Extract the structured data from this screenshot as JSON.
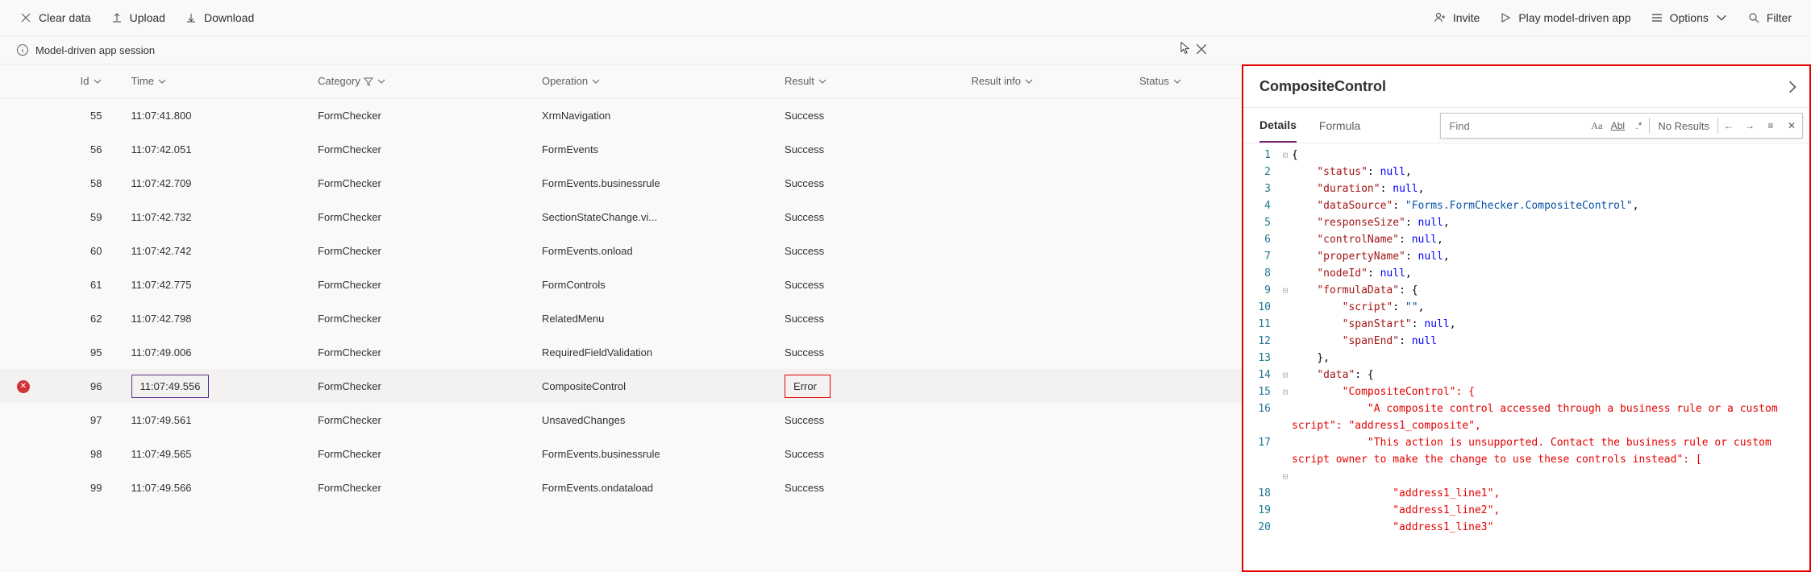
{
  "toolbar": {
    "left": {
      "clear": "Clear data",
      "upload": "Upload",
      "download": "Download"
    },
    "right": {
      "invite": "Invite",
      "play": "Play model-driven app",
      "options": "Options",
      "filter": "Filter"
    }
  },
  "session_bar": "Model-driven app session",
  "grid": {
    "headers": {
      "id": "Id",
      "time": "Time",
      "category": "Category",
      "operation": "Operation",
      "result": "Result",
      "result_info": "Result info",
      "status": "Status"
    },
    "rows": [
      {
        "id": "55",
        "time": "11:07:41.800",
        "category": "FormChecker",
        "operation": "XrmNavigation",
        "result": "Success",
        "err": false,
        "sel": false
      },
      {
        "id": "56",
        "time": "11:07:42.051",
        "category": "FormChecker",
        "operation": "FormEvents",
        "result": "Success",
        "err": false,
        "sel": false
      },
      {
        "id": "58",
        "time": "11:07:42.709",
        "category": "FormChecker",
        "operation": "FormEvents.businessrule",
        "result": "Success",
        "err": false,
        "sel": false
      },
      {
        "id": "59",
        "time": "11:07:42.732",
        "category": "FormChecker",
        "operation": "SectionStateChange.vi...",
        "result": "Success",
        "err": false,
        "sel": false
      },
      {
        "id": "60",
        "time": "11:07:42.742",
        "category": "FormChecker",
        "operation": "FormEvents.onload",
        "result": "Success",
        "err": false,
        "sel": false
      },
      {
        "id": "61",
        "time": "11:07:42.775",
        "category": "FormChecker",
        "operation": "FormControls",
        "result": "Success",
        "err": false,
        "sel": false
      },
      {
        "id": "62",
        "time": "11:07:42.798",
        "category": "FormChecker",
        "operation": "RelatedMenu",
        "result": "Success",
        "err": false,
        "sel": false
      },
      {
        "id": "95",
        "time": "11:07:49.006",
        "category": "FormChecker",
        "operation": "RequiredFieldValidation",
        "result": "Success",
        "err": false,
        "sel": false
      },
      {
        "id": "96",
        "time": "11:07:49.556",
        "category": "FormChecker",
        "operation": "CompositeControl",
        "result": "Error",
        "err": true,
        "sel": true
      },
      {
        "id": "97",
        "time": "11:07:49.561",
        "category": "FormChecker",
        "operation": "UnsavedChanges",
        "result": "Success",
        "err": false,
        "sel": false
      },
      {
        "id": "98",
        "time": "11:07:49.565",
        "category": "FormChecker",
        "operation": "FormEvents.businessrule",
        "result": "Success",
        "err": false,
        "sel": false
      },
      {
        "id": "99",
        "time": "11:07:49.566",
        "category": "FormChecker",
        "operation": "FormEvents.ondataload",
        "result": "Success",
        "err": false,
        "sel": false
      }
    ]
  },
  "right": {
    "title": "CompositeControl",
    "tabs": {
      "details": "Details",
      "formula": "Formula"
    },
    "find": {
      "placeholder": "Find",
      "results": "No Results"
    },
    "code": [
      {
        "n": 1,
        "fold": "⊟",
        "indent": 0,
        "tokens": [
          {
            "t": "{",
            "c": "brace"
          }
        ]
      },
      {
        "n": 2,
        "fold": "",
        "indent": 1,
        "tokens": [
          {
            "t": "\"status\"",
            "c": "key"
          },
          {
            "t": ": ",
            "c": "punct"
          },
          {
            "t": "null",
            "c": "null"
          },
          {
            "t": ",",
            "c": "punct"
          }
        ]
      },
      {
        "n": 3,
        "fold": "",
        "indent": 1,
        "tokens": [
          {
            "t": "\"duration\"",
            "c": "key"
          },
          {
            "t": ": ",
            "c": "punct"
          },
          {
            "t": "null",
            "c": "null"
          },
          {
            "t": ",",
            "c": "punct"
          }
        ]
      },
      {
        "n": 4,
        "fold": "",
        "indent": 1,
        "tokens": [
          {
            "t": "\"dataSource\"",
            "c": "key"
          },
          {
            "t": ": ",
            "c": "punct"
          },
          {
            "t": "\"Forms.FormChecker.CompositeControl\"",
            "c": "str"
          },
          {
            "t": ",",
            "c": "punct"
          }
        ]
      },
      {
        "n": 5,
        "fold": "",
        "indent": 1,
        "tokens": [
          {
            "t": "\"responseSize\"",
            "c": "key"
          },
          {
            "t": ": ",
            "c": "punct"
          },
          {
            "t": "null",
            "c": "null"
          },
          {
            "t": ",",
            "c": "punct"
          }
        ]
      },
      {
        "n": 6,
        "fold": "",
        "indent": 1,
        "tokens": [
          {
            "t": "\"controlName\"",
            "c": "key"
          },
          {
            "t": ": ",
            "c": "punct"
          },
          {
            "t": "null",
            "c": "null"
          },
          {
            "t": ",",
            "c": "punct"
          }
        ]
      },
      {
        "n": 7,
        "fold": "",
        "indent": 1,
        "tokens": [
          {
            "t": "\"propertyName\"",
            "c": "key"
          },
          {
            "t": ": ",
            "c": "punct"
          },
          {
            "t": "null",
            "c": "null"
          },
          {
            "t": ",",
            "c": "punct"
          }
        ]
      },
      {
        "n": 8,
        "fold": "",
        "indent": 1,
        "tokens": [
          {
            "t": "\"nodeId\"",
            "c": "key"
          },
          {
            "t": ": ",
            "c": "punct"
          },
          {
            "t": "null",
            "c": "null"
          },
          {
            "t": ",",
            "c": "punct"
          }
        ]
      },
      {
        "n": 9,
        "fold": "⊟",
        "indent": 1,
        "tokens": [
          {
            "t": "\"formulaData\"",
            "c": "key"
          },
          {
            "t": ": {",
            "c": "punct"
          }
        ]
      },
      {
        "n": 10,
        "fold": "",
        "indent": 2,
        "tokens": [
          {
            "t": "\"script\"",
            "c": "key"
          },
          {
            "t": ": ",
            "c": "punct"
          },
          {
            "t": "\"\"",
            "c": "str"
          },
          {
            "t": ",",
            "c": "punct"
          }
        ]
      },
      {
        "n": 11,
        "fold": "",
        "indent": 2,
        "tokens": [
          {
            "t": "\"spanStart\"",
            "c": "key"
          },
          {
            "t": ": ",
            "c": "punct"
          },
          {
            "t": "null",
            "c": "null"
          },
          {
            "t": ",",
            "c": "punct"
          }
        ]
      },
      {
        "n": 12,
        "fold": "",
        "indent": 2,
        "tokens": [
          {
            "t": "\"spanEnd\"",
            "c": "key"
          },
          {
            "t": ": ",
            "c": "punct"
          },
          {
            "t": "null",
            "c": "null"
          }
        ]
      },
      {
        "n": 13,
        "fold": "",
        "indent": 1,
        "tokens": [
          {
            "t": "},",
            "c": "punct"
          }
        ]
      },
      {
        "n": 14,
        "fold": "⊟",
        "indent": 1,
        "tokens": [
          {
            "t": "\"data\"",
            "c": "key"
          },
          {
            "t": ": {",
            "c": "punct"
          }
        ]
      },
      {
        "n": 15,
        "fold": "⊟",
        "indent": 2,
        "tokens": [
          {
            "t": "\"CompositeControl\"",
            "c": "err"
          },
          {
            "t": ": {",
            "c": "err"
          }
        ]
      },
      {
        "n": 16,
        "fold": "",
        "indent": 3,
        "tokens": [
          {
            "t": "\"A composite control accessed through a business rule or a custom script\"",
            "c": "err"
          },
          {
            "t": ": ",
            "c": "err"
          },
          {
            "t": "\"address1_composite\"",
            "c": "err"
          },
          {
            "t": ",",
            "c": "err"
          }
        ]
      },
      {
        "n": 17,
        "fold": "",
        "indent": 3,
        "tokens": [
          {
            "t": "\"This action is unsupported. Contact the business rule or custom script owner to make the change to use these controls instead\"",
            "c": "err"
          },
          {
            "t": ": [",
            "c": "err"
          }
        ]
      },
      {
        "n": "",
        "fold": "⊟",
        "indent": 3,
        "tokens": []
      },
      {
        "n": 18,
        "fold": "",
        "indent": 4,
        "tokens": [
          {
            "t": "\"address1_line1\"",
            "c": "err"
          },
          {
            "t": ",",
            "c": "err"
          }
        ]
      },
      {
        "n": 19,
        "fold": "",
        "indent": 4,
        "tokens": [
          {
            "t": "\"address1_line2\"",
            "c": "err"
          },
          {
            "t": ",",
            "c": "err"
          }
        ]
      },
      {
        "n": 20,
        "fold": "",
        "indent": 4,
        "tokens": [
          {
            "t": "\"address1_line3\"",
            "c": "err"
          }
        ]
      }
    ]
  }
}
